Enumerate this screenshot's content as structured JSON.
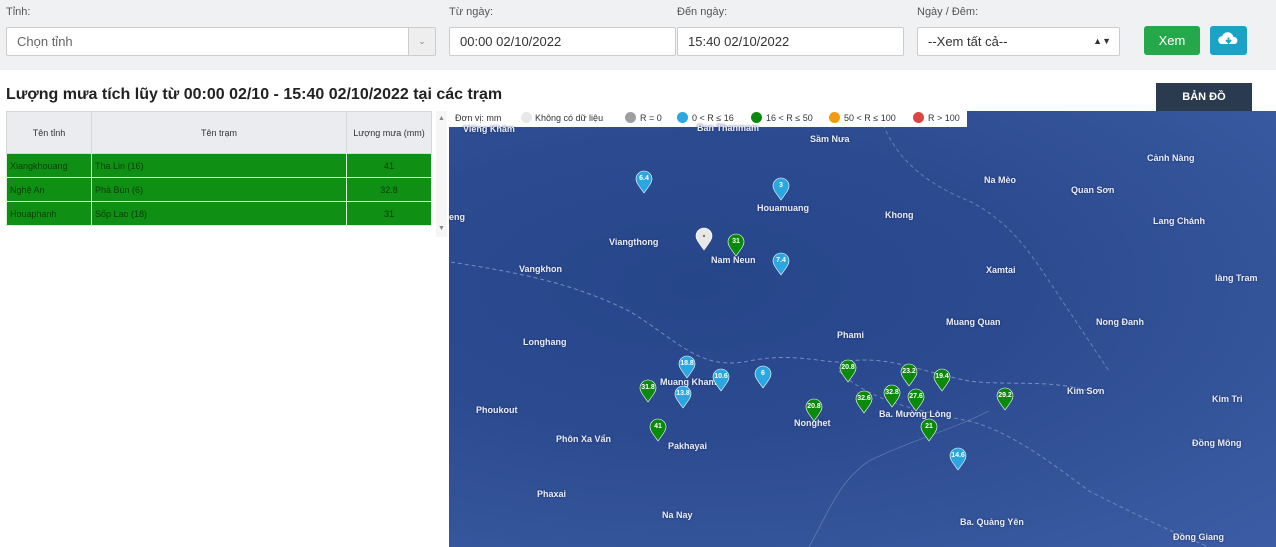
{
  "filters": {
    "province_label": "Tỉnh:",
    "province_value": "Chọn tỉnh",
    "from_label": "Từ ngày:",
    "from_value": "00:00 02/10/2022",
    "to_label": "Đến ngày:",
    "to_value": "15:40 02/10/2022",
    "daynight_label": "Ngày / Đêm:",
    "daynight_value": "--Xem tất cả--",
    "view_button": "Xem"
  },
  "title": "Lượng mưa tích lũy từ 00:00 02/10 - 15:40 02/10/2022 tại các trạm",
  "map_button": "BẢN ĐỒ",
  "table": {
    "headers": [
      "Tên tỉnh",
      "Tên trạm",
      "Lượng mưa (mm)"
    ],
    "rows": [
      [
        "Xiangkhouang",
        "Tha Lin (16)",
        "41"
      ],
      [
        "Nghệ An",
        "Phà Bún (6)",
        "32.8"
      ],
      [
        "Houaphanh",
        "Sốp Lao (18)",
        "31"
      ]
    ]
  },
  "legend": {
    "unit": "Đơn vị: mm",
    "items": [
      {
        "label": "Không có dữ liệu",
        "color": "#e8e8e8"
      },
      {
        "label": "R = 0",
        "color": "#9e9e9e"
      },
      {
        "label": "0 < R ≤ 16",
        "color": "#2aa6e0"
      },
      {
        "label": "16 < R ≤ 50",
        "color": "#0a8a0a"
      },
      {
        "label": "50 < R ≤ 100",
        "color": "#f39a12"
      },
      {
        "label": "R > 100",
        "color": "#dd4444"
      }
    ]
  },
  "places": [
    "Viêng Khăm",
    "Ban Thanmam",
    "Sầm Nưa",
    "Cảnh Nàng",
    "Na Mèo",
    "Quan Sơn",
    "Houamuang",
    "Khong",
    "Lang Chánh",
    "eng",
    "Viangthong",
    "Nam Neun",
    "Vangkhon",
    "Xamtai",
    "làng Tram",
    "Phami",
    "Muang Quan",
    "Nong Đanh",
    "Longhang",
    "Muang Kham",
    "Ba. Mường Lòng",
    "Kim Sơn",
    "Kim Tri",
    "Phoukout",
    "Nonghet",
    "Phôn Xa Vẩn",
    "Đồng Mông",
    "Pakhayai",
    "Phaxai",
    "Na Nay",
    "Ba. Quảng Yên",
    "Đồng Giang"
  ],
  "markers": [
    {
      "value": "6.4",
      "color": "#2aa6e0"
    },
    {
      "value": "3",
      "color": "#2aa6e0"
    },
    {
      "value": "",
      "color": "#e8e8e8"
    },
    {
      "value": "31",
      "color": "#0a8a0a"
    },
    {
      "value": "7.4",
      "color": "#2aa6e0"
    },
    {
      "value": "18.8",
      "color": "#2aa6e0"
    },
    {
      "value": "10.6",
      "color": "#2aa6e0"
    },
    {
      "value": "6",
      "color": "#2aa6e0"
    },
    {
      "value": "13.8",
      "color": "#2aa6e0"
    },
    {
      "value": "31.8",
      "color": "#0a8a0a"
    },
    {
      "value": "41",
      "color": "#0a8a0a"
    },
    {
      "value": "20.8",
      "color": "#0a8a0a"
    },
    {
      "value": "23.2",
      "color": "#0a8a0a"
    },
    {
      "value": "19.4",
      "color": "#0a8a0a"
    },
    {
      "value": "32.8",
      "color": "#0a8a0a"
    },
    {
      "value": "32.6",
      "color": "#0a8a0a"
    },
    {
      "value": "27.6",
      "color": "#0a8a0a"
    },
    {
      "value": "20.8",
      "color": "#0a8a0a"
    },
    {
      "value": "21",
      "color": "#0a8a0a"
    },
    {
      "value": "29.2",
      "color": "#0a8a0a"
    },
    {
      "value": "14.6",
      "color": "#2aa6e0"
    }
  ]
}
